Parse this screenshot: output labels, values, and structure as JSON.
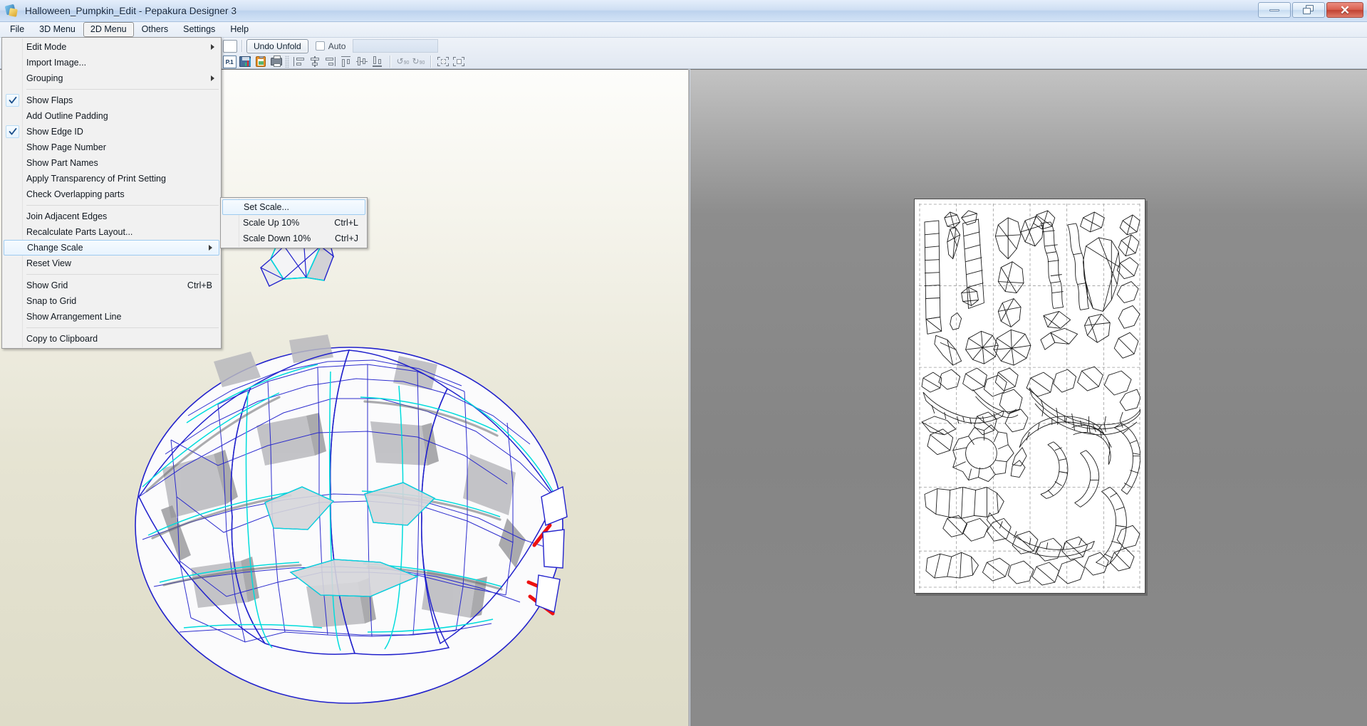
{
  "window": {
    "title": "Halloween_Pumpkin_Edit - Pepakura Designer 3",
    "app_icon": "pepakura-icon",
    "minimize_label": "–",
    "restore_label": "❐",
    "close_label": "✕"
  },
  "menubar": {
    "items": [
      {
        "label": "File",
        "active": false
      },
      {
        "label": "3D Menu",
        "active": false
      },
      {
        "label": "2D Menu",
        "active": true
      },
      {
        "label": "Others",
        "active": false
      },
      {
        "label": "Settings",
        "active": false
      },
      {
        "label": "Help",
        "active": false
      }
    ]
  },
  "toolbar": {
    "undo_unfold_label": "Undo Unfold",
    "auto_label": "Auto",
    "auto_checked": false,
    "page_indicator": "P.1",
    "icons": [
      "new-document-icon",
      "save-icon",
      "copy-to-clipboard-icon",
      "print-icon",
      "align-left-icon",
      "align-center-horizontal-icon",
      "align-right-icon",
      "align-top-icon",
      "align-center-vertical-icon",
      "align-bottom-icon",
      "rotate-left-90-icon",
      "rotate-right-90-icon",
      "group-parts-icon",
      "ungroup-parts-icon"
    ]
  },
  "menu_2d": {
    "title": "2D Menu",
    "items": [
      {
        "label": "Edit Mode",
        "checked": false,
        "shortcut": "",
        "submenu": true,
        "separator_after": false,
        "highlighted": false
      },
      {
        "label": "Import Image...",
        "checked": false,
        "shortcut": "",
        "submenu": false,
        "separator_after": false,
        "highlighted": false
      },
      {
        "label": "Grouping",
        "checked": false,
        "shortcut": "",
        "submenu": true,
        "separator_after": true,
        "highlighted": false
      },
      {
        "label": "Show Flaps",
        "checked": true,
        "shortcut": "",
        "submenu": false,
        "separator_after": false,
        "highlighted": false
      },
      {
        "label": "Add Outline Padding",
        "checked": false,
        "shortcut": "",
        "submenu": false,
        "separator_after": false,
        "highlighted": false
      },
      {
        "label": "Show Edge ID",
        "checked": true,
        "shortcut": "",
        "submenu": false,
        "separator_after": false,
        "highlighted": false
      },
      {
        "label": "Show Page Number",
        "checked": false,
        "shortcut": "",
        "submenu": false,
        "separator_after": false,
        "highlighted": false
      },
      {
        "label": "Show Part Names",
        "checked": false,
        "shortcut": "",
        "submenu": false,
        "separator_after": false,
        "highlighted": false
      },
      {
        "label": "Apply Transparency of Print Setting",
        "checked": false,
        "shortcut": "",
        "submenu": false,
        "separator_after": false,
        "highlighted": false
      },
      {
        "label": "Check Overlapping parts",
        "checked": false,
        "shortcut": "",
        "submenu": false,
        "separator_after": true,
        "highlighted": false
      },
      {
        "label": "Join Adjacent Edges",
        "checked": false,
        "shortcut": "",
        "submenu": false,
        "separator_after": false,
        "highlighted": false
      },
      {
        "label": "Recalculate Parts Layout...",
        "checked": false,
        "shortcut": "",
        "submenu": false,
        "separator_after": false,
        "highlighted": false
      },
      {
        "label": "Change Scale",
        "checked": false,
        "shortcut": "",
        "submenu": true,
        "separator_after": false,
        "highlighted": true
      },
      {
        "label": "Reset View",
        "checked": false,
        "shortcut": "",
        "submenu": false,
        "separator_after": true,
        "highlighted": false
      },
      {
        "label": "Show Grid",
        "checked": false,
        "shortcut": "Ctrl+B",
        "submenu": false,
        "separator_after": false,
        "highlighted": false
      },
      {
        "label": "Snap to Grid",
        "checked": false,
        "shortcut": "",
        "submenu": false,
        "separator_after": false,
        "highlighted": false
      },
      {
        "label": "Show Arrangement Line",
        "checked": false,
        "shortcut": "",
        "submenu": false,
        "separator_after": true,
        "highlighted": false
      },
      {
        "label": "Copy to Clipboard",
        "checked": false,
        "shortcut": "",
        "submenu": false,
        "separator_after": false,
        "highlighted": false
      }
    ]
  },
  "submenu_change_scale": {
    "parent": "Change Scale",
    "items": [
      {
        "label": "Set Scale...",
        "shortcut": "",
        "highlighted": true
      },
      {
        "label": "Scale Up 10%",
        "shortcut": "Ctrl+L",
        "highlighted": false
      },
      {
        "label": "Scale Down 10%",
        "shortcut": "Ctrl+J",
        "highlighted": false
      }
    ]
  },
  "viewport_3d": {
    "name": "3d-model-view",
    "model": "Halloween pumpkin low-poly unfolded model",
    "background_top": "#fdfdfb",
    "background_bottom": "#dedcc8",
    "edge_color": "#2222cc",
    "fold_color": "#00e0e0",
    "face_color": "#ffffff",
    "shadow_color": "#9a9a9a",
    "highlight_color": "#ee1111"
  },
  "viewport_2d": {
    "name": "2d-pattern-view",
    "background": "#858585",
    "page_count": 1,
    "current_page": "P.1",
    "sheet_background": "#ffffff",
    "grid_line_color": "#9a9a9a",
    "part_line_color": "#1a1a1a"
  }
}
